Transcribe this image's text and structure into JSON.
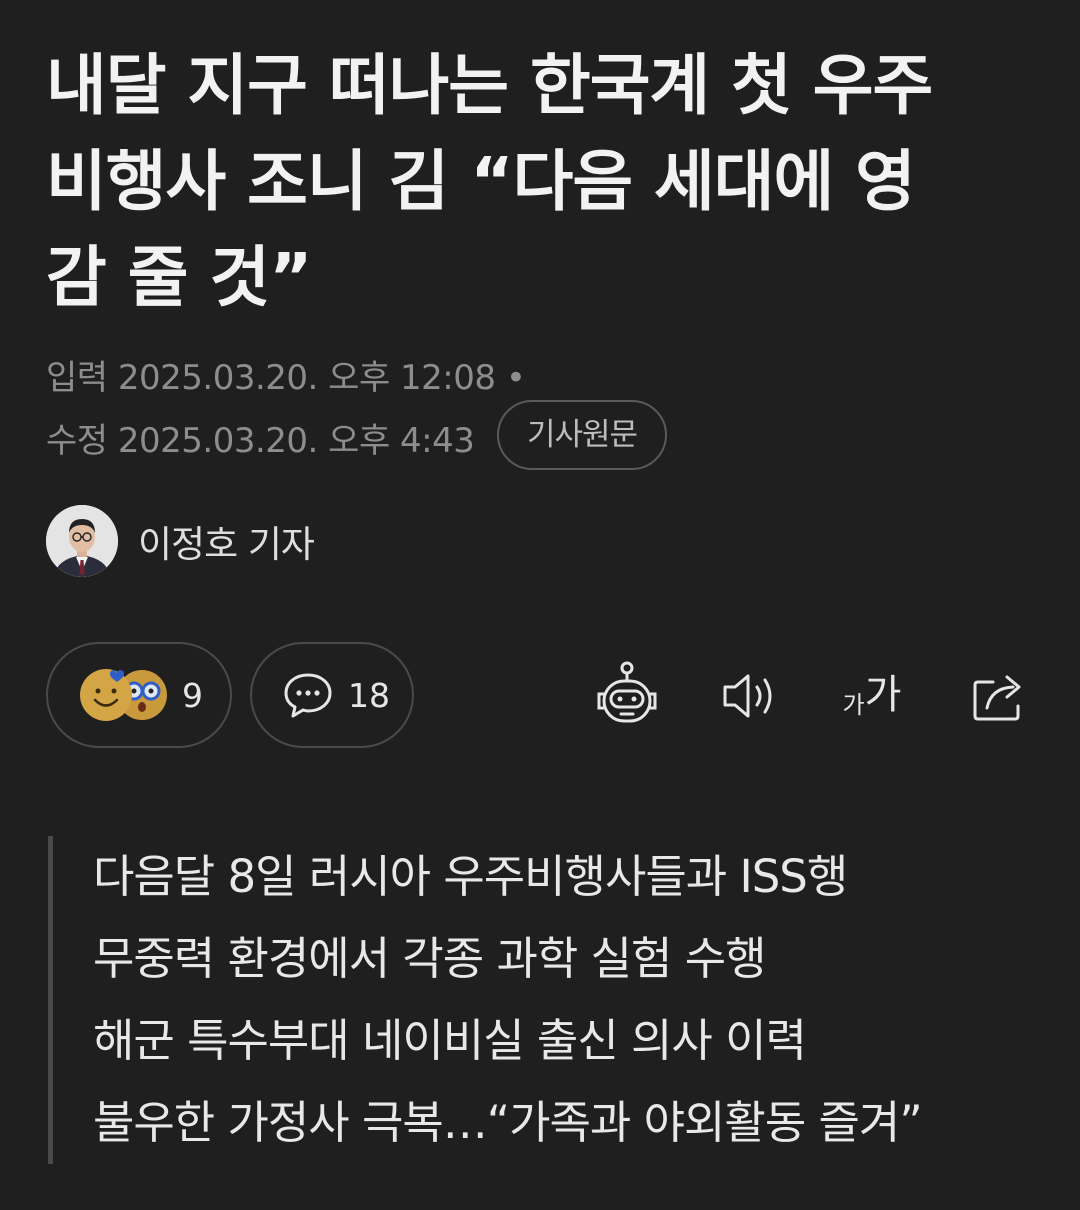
{
  "article": {
    "title_lines": [
      "내달 지구 떠나는 한국계 첫 우주",
      "비행사 조니 김 “다음 세대에 영",
      "감 줄 것”"
    ],
    "input_label": "입력",
    "input_datetime": "2025.03.20. 오후 12:08",
    "edit_label": "수정",
    "edit_datetime": "2025.03.20. 오후 4:43",
    "original_button": "기사원문",
    "author_name": "이정호 기자"
  },
  "actions": {
    "reaction_count": "9",
    "comment_count": "18",
    "font_size_small": "가",
    "font_size_large": "가",
    "icons": [
      "smile-emoji-icon",
      "surprised-emoji-icon",
      "comment-icon",
      "ai-robot-icon",
      "speaker-icon",
      "font-size-icon",
      "share-icon"
    ]
  },
  "summary": [
    "다음달 8일 러시아 우주비행사들과 ISS행",
    "무중력 환경에서 각종 과학 실험 수행",
    "해군 특수부대 네이비실 출신 의사 이력",
    "불우한 가정사 극복…“가족과 야외활동 즐겨”"
  ],
  "colors": {
    "background": "#1f1f1f",
    "title": "#f2f2f2",
    "meta": "#8d8d8d",
    "border": "#4a4a4a"
  }
}
